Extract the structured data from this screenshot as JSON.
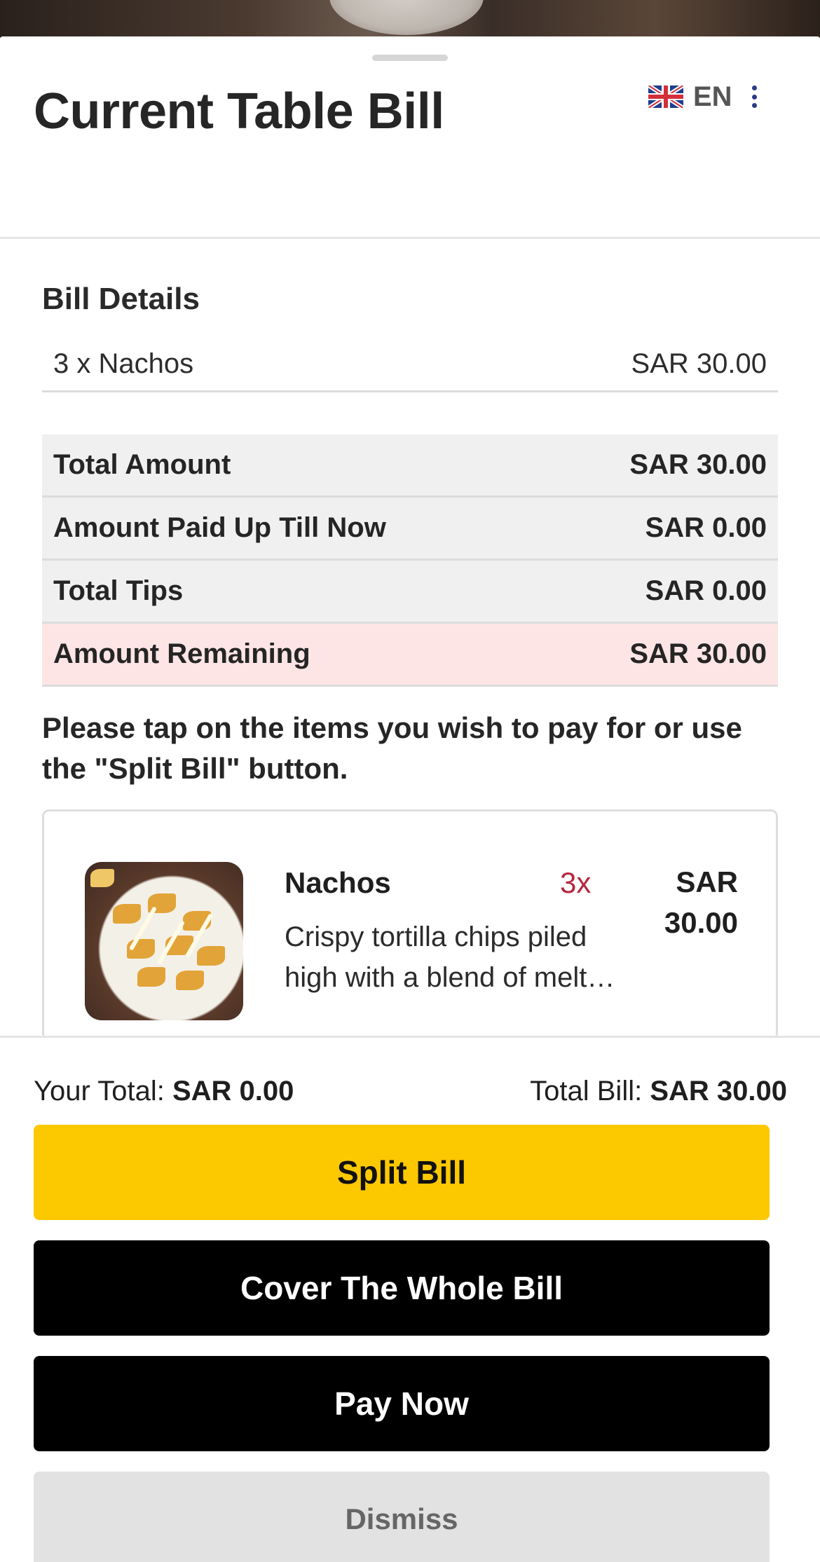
{
  "header": {
    "title": "Current Table Bill",
    "language_code": "EN",
    "flag_icon": "uk-flag-icon",
    "menu_icon": "kebab-menu-icon"
  },
  "bill_details": {
    "heading": "Bill Details",
    "lines": [
      {
        "description": "3 x Nachos",
        "amount": "SAR 30.00"
      }
    ]
  },
  "summary": {
    "total_amount_label": "Total Amount",
    "total_amount_value": "SAR 30.00",
    "paid_label": "Amount Paid Up Till Now",
    "paid_value": "SAR 0.00",
    "tips_label": "Total Tips",
    "tips_value": "SAR 0.00",
    "remaining_label": "Amount Remaining",
    "remaining_value": "SAR 30.00",
    "remaining_bg": "#fde5e6"
  },
  "instructions": "Please tap on the items you wish to pay for or use the \"Split Bill\" button.",
  "items": [
    {
      "name": "Nachos",
      "quantity": "3x",
      "price": "SAR 30.00",
      "description": "Crispy tortilla chips piled high with a blend of melted cheese",
      "qty_color": "#b5283f"
    }
  ],
  "footer": {
    "your_total_label": "Your Total:",
    "your_total_value": "SAR 0.00",
    "total_bill_label": "Total Bill:",
    "total_bill_value": "SAR 30.00",
    "split_bill": "Split Bill",
    "cover_whole_bill": "Cover The Whole Bill",
    "pay_now": "Pay Now",
    "dismiss": "Dismiss"
  },
  "colors": {
    "accent_yellow": "#fcc800",
    "primary_black": "#000000",
    "dismiss_gray": "#e2e2e2"
  }
}
